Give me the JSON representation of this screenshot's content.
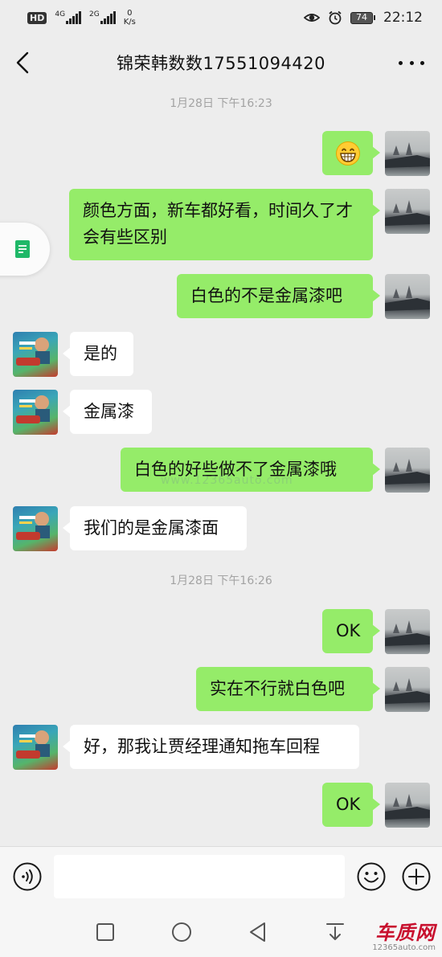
{
  "status_bar": {
    "hd_label": "HD",
    "sim1_network": "4G",
    "sim2_network": "2G",
    "net_speed_value": "0",
    "net_speed_unit": "K/s",
    "battery_level": "74",
    "time": "22:12",
    "icons": [
      "eye-icon",
      "alarm-icon"
    ]
  },
  "header": {
    "title": "锦荣韩数数17551094420",
    "back_icon": "chevron-left-icon",
    "more_icon": "more-dots-icon"
  },
  "timestamps": [
    "1月28日 下午16:23",
    "1月28日 下午16:26"
  ],
  "messages": [
    {
      "from": "me",
      "type": "emoji",
      "emoji": "😁",
      "text": ""
    },
    {
      "from": "me",
      "type": "text",
      "text": "颜色方面，新车都好看，时间久了才会有些区别"
    },
    {
      "from": "me",
      "type": "text",
      "text": "白色的不是金属漆吧"
    },
    {
      "from": "them",
      "type": "text",
      "text": "是的"
    },
    {
      "from": "them",
      "type": "text",
      "text": "金属漆"
    },
    {
      "from": "me",
      "type": "text",
      "text": "白色的好些做不了金属漆哦"
    },
    {
      "from": "them",
      "type": "text",
      "text": "我们的是金属漆面"
    },
    {
      "from": "me",
      "type": "text",
      "text": "OK"
    },
    {
      "from": "me",
      "type": "text",
      "text": "实在不行就白色吧"
    },
    {
      "from": "them",
      "type": "text",
      "text": "好，那我让贾经理通知拖车回程"
    },
    {
      "from": "me",
      "type": "text",
      "text": "OK"
    }
  ],
  "watermark": "www.12365auto.com",
  "input_bar": {
    "placeholder": "",
    "value": "",
    "icons": [
      "voice-icon",
      "emoji-icon",
      "plus-icon"
    ]
  },
  "nav_bar": {
    "icons": [
      "recent-apps-icon",
      "home-icon",
      "back-triangle-icon",
      "notification-pull-icon"
    ]
  },
  "site_logo": {
    "main": "车质网",
    "sub": "12365auto.com"
  },
  "colors": {
    "background": "#ededed",
    "my_bubble": "#95ec69",
    "their_bubble": "#ffffff",
    "timestamp": "#a3a3a3"
  }
}
